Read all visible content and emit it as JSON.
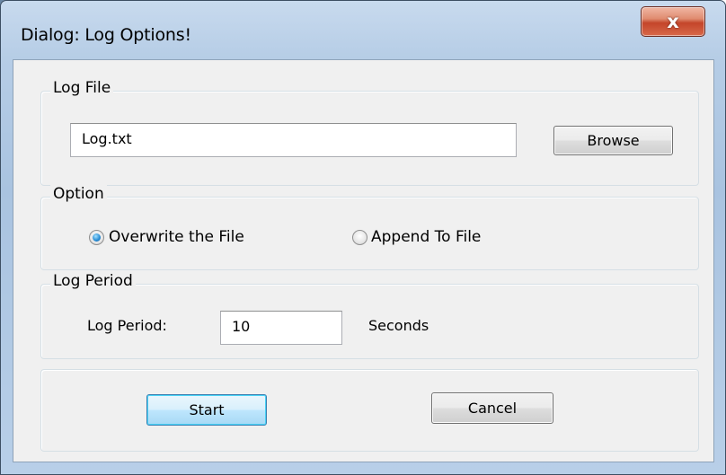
{
  "window": {
    "title": "Dialog: Log Options!",
    "close_glyph": "x"
  },
  "log_file_group": {
    "legend": "Log File",
    "file_value": "Log.txt",
    "browse_label": "Browse"
  },
  "option_group": {
    "legend": "Option",
    "radios": [
      {
        "label": "Overwrite the File",
        "checked": true
      },
      {
        "label": "Append To File",
        "checked": false
      }
    ]
  },
  "log_period_group": {
    "legend": "Log Period",
    "label": "Log Period:",
    "value": "10",
    "unit": "Seconds"
  },
  "actions": {
    "start_label": "Start",
    "cancel_label": "Cancel"
  },
  "colors": {
    "accent_default_button": "#3c7fb1",
    "close_button": "#c4452a",
    "titlebar": "#b6cde6",
    "client_background": "#f0f0f0"
  },
  "icons": {
    "close": "close-icon"
  }
}
